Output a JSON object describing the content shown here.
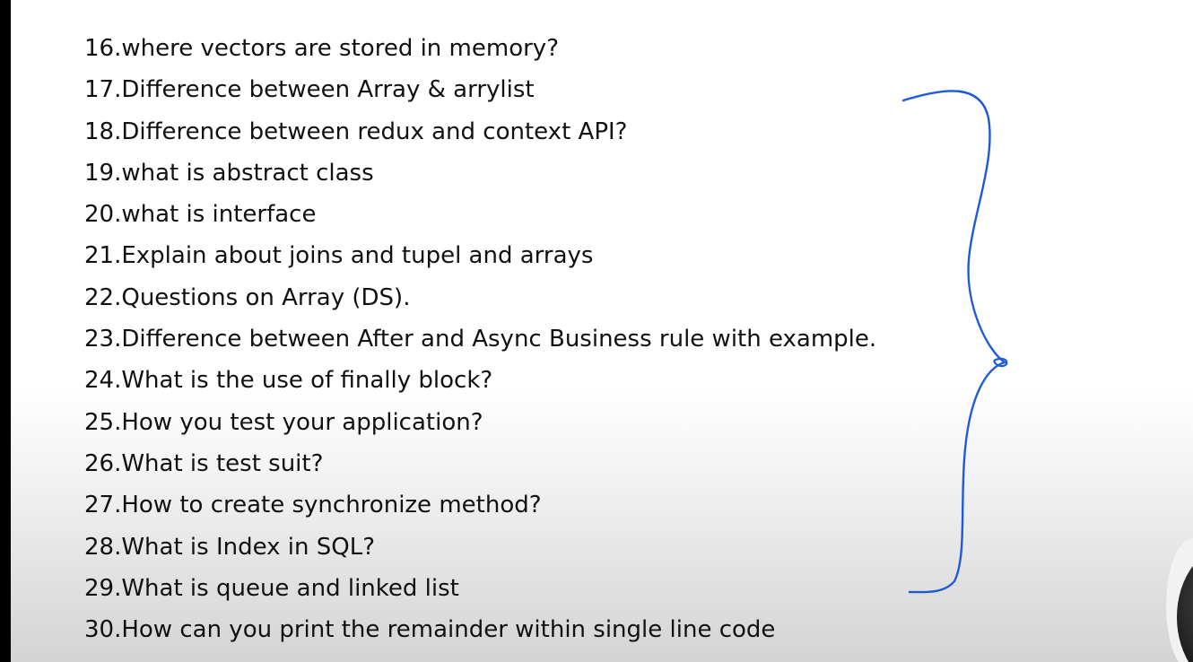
{
  "questions": [
    "16.where vectors are stored in memory?",
    "17.Difference between Array & arrylist",
    "18.Difference between redux and context API?",
    "19.what is abstract class",
    "20.what is interface",
    "21.Explain about joins and tupel and arrays",
    "22.Questions on Array (DS).",
    "23.Difference between After and Async Business rule with example.",
    "24.What is the use of finally block?",
    "25.How you test your application?",
    "26.What is test suit?",
    "27.How to create synchronize method?",
    "28.What is Index in SQL?",
    "29.What is queue and linked list",
    "30.How can you print the remainder within single line code"
  ],
  "colors": {
    "text": "#111111",
    "brace": "#1f5bd6",
    "left_bar": "#000000"
  },
  "icons": {
    "annotation": "curly-brace-annotation",
    "overlay": "webcam-overlay"
  }
}
